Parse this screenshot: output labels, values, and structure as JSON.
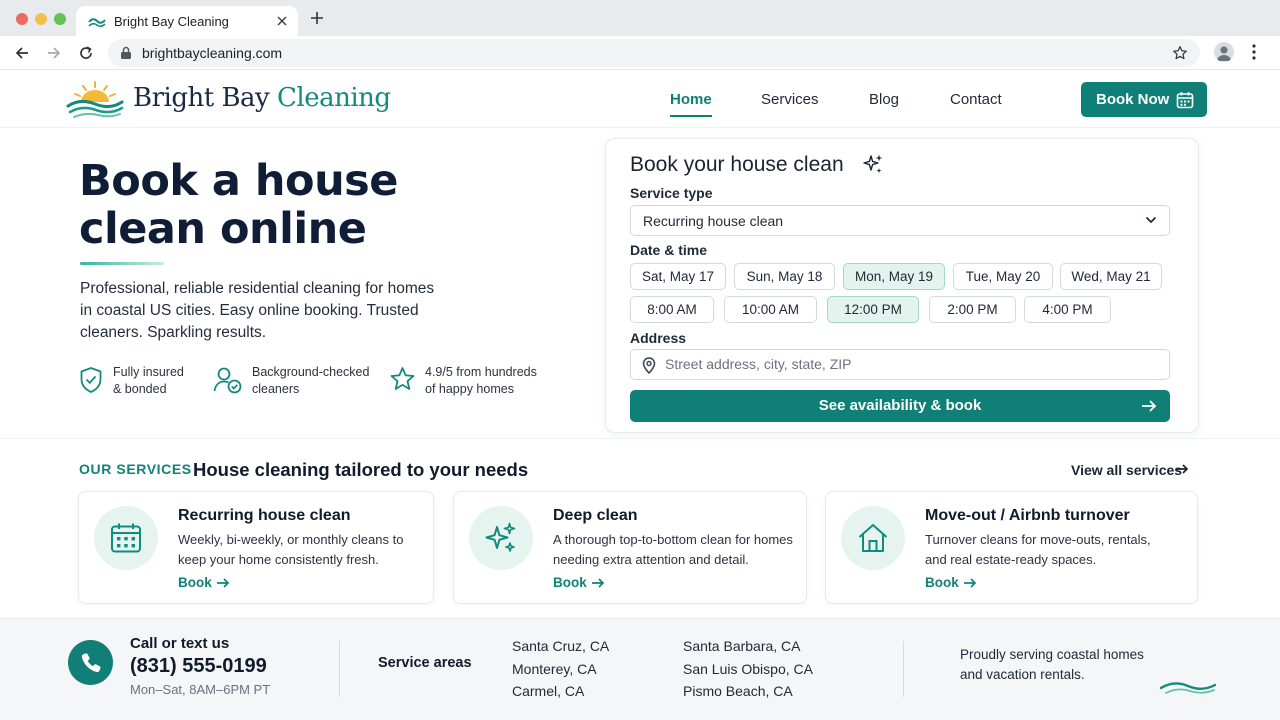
{
  "browser": {
    "tab_title": "Bright Bay Cleaning",
    "url": "brightbaycleaning.com"
  },
  "header": {
    "brand_part1": "Bright Bay",
    "brand_part2": "Cleaning",
    "nav": [
      {
        "label": "Home",
        "active": true
      },
      {
        "label": "Services",
        "active": false
      },
      {
        "label": "Blog",
        "active": false
      },
      {
        "label": "Contact",
        "active": false
      }
    ],
    "cta_label": "Book Now"
  },
  "hero": {
    "title_line1": "Book a house",
    "title_line2": "clean online",
    "description": "Professional, reliable residential cleaning for homes in coastal US cities. Easy online booking. Trusted cleaners. Sparkling results.",
    "features": [
      {
        "icon": "shield-check-icon",
        "line1": "Fully insured",
        "line2": "& bonded"
      },
      {
        "icon": "user-check-icon",
        "line1": "Background-checked",
        "line2": "cleaners"
      },
      {
        "icon": "star-icon",
        "line1": "4.9/5 from hundreds",
        "line2": "of happy homes"
      }
    ]
  },
  "booking": {
    "title": "Book your house clean",
    "service_type_label": "Service type",
    "service_type_value": "Recurring house clean",
    "datetime_label": "Date & time",
    "dates": [
      {
        "label": "Sat, May 17",
        "selected": false
      },
      {
        "label": "Sun, May 18",
        "selected": false
      },
      {
        "label": "Mon, May 19",
        "selected": true
      },
      {
        "label": "Tue, May 20",
        "selected": false
      },
      {
        "label": "Wed, May 21",
        "selected": false
      }
    ],
    "times": [
      {
        "label": "8:00 AM",
        "selected": false
      },
      {
        "label": "10:00 AM",
        "selected": false
      },
      {
        "label": "12:00 PM",
        "selected": true
      },
      {
        "label": "2:00 PM",
        "selected": false
      },
      {
        "label": "4:00 PM",
        "selected": false
      }
    ],
    "address_label": "Address",
    "address_placeholder": "Street address, city, state, ZIP",
    "submit_label": "See availability & book"
  },
  "services": {
    "eyebrow": "OUR SERVICES",
    "title": "House cleaning tailored to your needs",
    "view_all": "View all services",
    "items": [
      {
        "title": "Recurring house clean",
        "description": "Weekly, bi-weekly, or monthly cleans to keep your home consistently fresh.",
        "link": "Book",
        "icon": "calendar-icon"
      },
      {
        "title": "Deep clean",
        "description": "A thorough top-to-bottom clean for homes needing extra attention and detail.",
        "link": "Book",
        "icon": "sparkle-icon"
      },
      {
        "title": "Move-out / Airbnb turnover",
        "description": "Turnover cleans for move-outs, rentals, and real estate-ready spaces.",
        "link": "Book",
        "icon": "house-icon"
      }
    ]
  },
  "footer": {
    "call_label": "Call or text us",
    "phone": "(831) 555-0199",
    "hours": "Mon–Sat, 8AM–6PM PT",
    "areas_label": "Service areas",
    "areas_col1": [
      "Santa Cruz, CA",
      "Monterey, CA",
      "Carmel, CA"
    ],
    "areas_col2": [
      "Santa Barbara, CA",
      "San Luis Obispo, CA",
      "Pismo Beach, CA"
    ],
    "tagline": "Proudly serving coastal homes and vacation rentals."
  },
  "colors": {
    "accent": "#0f7f78",
    "brand_navy": "#1b2a44",
    "chip_selected_bg": "#e3f4ee"
  }
}
